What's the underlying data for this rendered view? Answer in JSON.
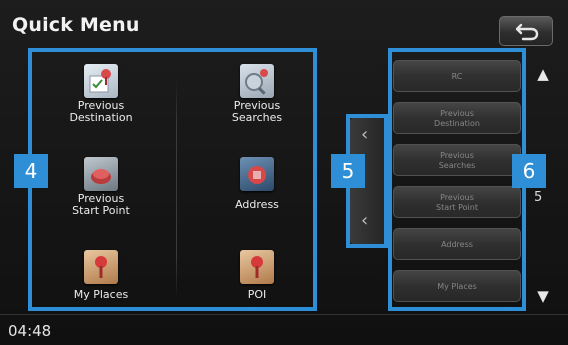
{
  "header": {
    "title": "Quick Menu",
    "back_icon": "return-arrow-icon"
  },
  "destinations": [
    {
      "label_lines": [
        "Previous",
        "Destination"
      ],
      "icon": "previous-destination-icon"
    },
    {
      "label_lines": [
        "Previous",
        "Searches"
      ],
      "icon": "previous-searches-icon"
    },
    {
      "label_lines": [
        "Previous",
        "Start Point"
      ],
      "icon": "previous-start-point-icon"
    },
    {
      "label_lines": [
        "Address"
      ],
      "icon": "address-icon"
    },
    {
      "label_lines": [
        "My Places"
      ],
      "icon": "my-places-icon"
    },
    {
      "label_lines": [
        "POI"
      ],
      "icon": "poi-icon"
    }
  ],
  "callouts": {
    "grid": "4",
    "handle": "5",
    "submenu": "6"
  },
  "handle": {
    "chevron_left_icon": "chevron-left-icon"
  },
  "submenu": {
    "items": [
      {
        "lines": [
          "RC"
        ]
      },
      {
        "lines": [
          "Previous",
          "Destination"
        ]
      },
      {
        "lines": [
          "Previous",
          "Searches"
        ]
      },
      {
        "lines": [
          "Previous",
          "Start Point"
        ]
      },
      {
        "lines": [
          "Address"
        ]
      },
      {
        "lines": [
          "My Places"
        ]
      }
    ]
  },
  "scroll": {
    "up_icon": "arrow-up-icon",
    "down_icon": "arrow-down-icon",
    "page": "5"
  },
  "status": {
    "time": "04:48"
  },
  "colors": {
    "accent": "#2f8fd6",
    "background": "#161616",
    "text": "#ececec"
  }
}
